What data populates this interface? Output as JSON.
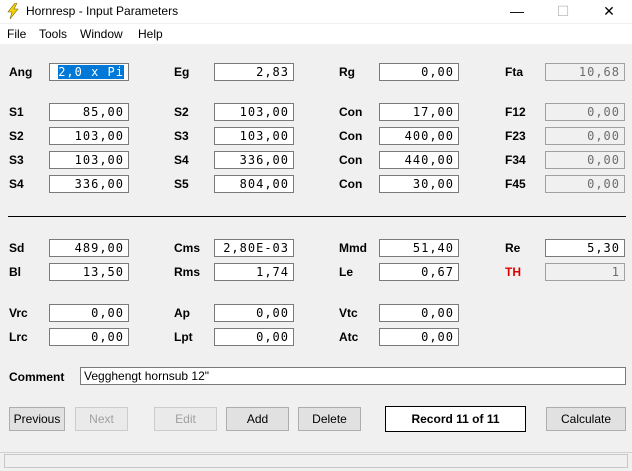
{
  "window": {
    "title": "Hornresp - Input Parameters",
    "icon": "lightning-bolt-icon",
    "controls": {
      "minimize": "—",
      "maximize": "☐",
      "close": "✕"
    }
  },
  "menu": {
    "file": "File",
    "tools": "Tools",
    "window": "Window",
    "help": "Help"
  },
  "params": {
    "ang": {
      "label": "Ang",
      "value": "2,0 x Pi"
    },
    "eg": {
      "label": "Eg",
      "value": "2,83"
    },
    "rg": {
      "label": "Rg",
      "value": "0,00"
    },
    "fta": {
      "label": "Fta",
      "value": "10,68"
    },
    "s1": {
      "label": "S1",
      "value": "85,00"
    },
    "s2a": {
      "label": "S2",
      "value": "103,00"
    },
    "con1": {
      "label": "Con",
      "value": "17,00"
    },
    "f12": {
      "label": "F12",
      "value": "0,00"
    },
    "s2b": {
      "label": "S2",
      "value": "103,00"
    },
    "s3a": {
      "label": "S3",
      "value": "103,00"
    },
    "con2": {
      "label": "Con",
      "value": "400,00"
    },
    "f23": {
      "label": "F23",
      "value": "0,00"
    },
    "s3b": {
      "label": "S3",
      "value": "103,00"
    },
    "s4a": {
      "label": "S4",
      "value": "336,00"
    },
    "con3": {
      "label": "Con",
      "value": "440,00"
    },
    "f34": {
      "label": "F34",
      "value": "0,00"
    },
    "s4b": {
      "label": "S4",
      "value": "336,00"
    },
    "s5": {
      "label": "S5",
      "value": "804,00"
    },
    "con4": {
      "label": "Con",
      "value": "30,00"
    },
    "f45": {
      "label": "F45",
      "value": "0,00"
    },
    "sd": {
      "label": "Sd",
      "value": "489,00"
    },
    "cms": {
      "label": "Cms",
      "value": "2,80E-03"
    },
    "mmd": {
      "label": "Mmd",
      "value": "51,40"
    },
    "re": {
      "label": "Re",
      "value": "5,30"
    },
    "bl": {
      "label": "Bl",
      "value": "13,50"
    },
    "rms": {
      "label": "Rms",
      "value": "1,74"
    },
    "le": {
      "label": "Le",
      "value": "0,67"
    },
    "th": {
      "label": "TH",
      "value": "1",
      "label_color": "#e00000"
    },
    "vrc": {
      "label": "Vrc",
      "value": "0,00"
    },
    "ap": {
      "label": "Ap",
      "value": "0,00"
    },
    "vtc": {
      "label": "Vtc",
      "value": "0,00"
    },
    "lrc": {
      "label": "Lrc",
      "value": "0,00"
    },
    "lpt": {
      "label": "Lpt",
      "value": "0,00"
    },
    "atc": {
      "label": "Atc",
      "value": "0,00"
    }
  },
  "comment": {
    "label": "Comment",
    "value": "Vegghengt hornsub 12\""
  },
  "buttons": {
    "previous": "Previous",
    "next": "Next",
    "edit": "Edit",
    "add": "Add",
    "delete": "Delete",
    "record": "Record 11 of 11",
    "calculate": "Calculate"
  }
}
